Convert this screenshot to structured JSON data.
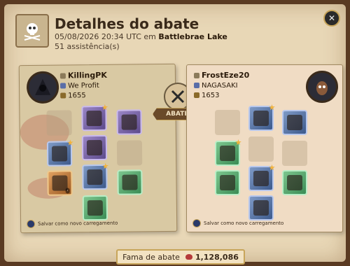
{
  "header": {
    "title": "Detalhes do abate",
    "datetime": "05/08/2026 20:34 UTC em",
    "location": "Battlebrae Lake",
    "assists": "51 assistência(s)"
  },
  "killer": {
    "name": "KillingPK",
    "guild": "We Profit",
    "item_power": "1655",
    "save_label": "Salvar como novo carregamento"
  },
  "victim": {
    "name": "FrostEze20",
    "guild": "NAGASAKI",
    "item_power": "1653",
    "save_label": "Salvar como novo carregamento"
  },
  "center": {
    "action_label": "ABATEU"
  },
  "footer": {
    "fame_label": "Fama de abate",
    "fame_value": "1,128,086"
  },
  "colors": {
    "accent_gold": "#c8a55a",
    "blood": "#b53a3a"
  }
}
